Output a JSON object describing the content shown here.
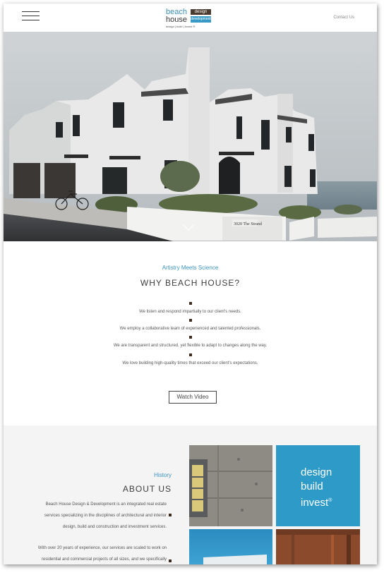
{
  "header": {
    "logo_word1": "beach",
    "logo_word2": "house",
    "logo_badge1": "design",
    "logo_badge2": "development",
    "logo_tagline": "design | build | invest ®",
    "contact_label": "Contact Us"
  },
  "hero": {
    "house_number": "3020 The Strand"
  },
  "why": {
    "kicker": "Artistry Meets Science",
    "title": "WHY BEACH HOUSE?",
    "items": [
      "We listen and respond impartially to our client's needs.",
      "We employ a collaborative team of experienced and talented professionals.",
      "We are transparent and structured, yet flexible to adapt to changes along the way.",
      "We love building high-quality times that exceed our client's expectations."
    ],
    "video_button": "Watch Video"
  },
  "about": {
    "kicker": "History",
    "title": "ABOUT US",
    "lines": [
      "Beach House Design & Development is an integrated real estate",
      "services specializing in the disciplines of architectural and interior",
      "design, build and construction and investment services.",
      "With over 20 years of experience, our services are scaled to work on",
      "residential and commercial projects of all sizes, and we specifically"
    ],
    "tile_text": [
      "design",
      "build",
      "invest"
    ],
    "tile_reg": "®"
  },
  "colors": {
    "accent_blue": "#3a93bd",
    "bullet_brown": "#3f2a1e",
    "tile_blue": "#2d9ac7"
  },
  "icons": {
    "menu": "hamburger-icon",
    "scroll": "chevron-down-icon"
  }
}
